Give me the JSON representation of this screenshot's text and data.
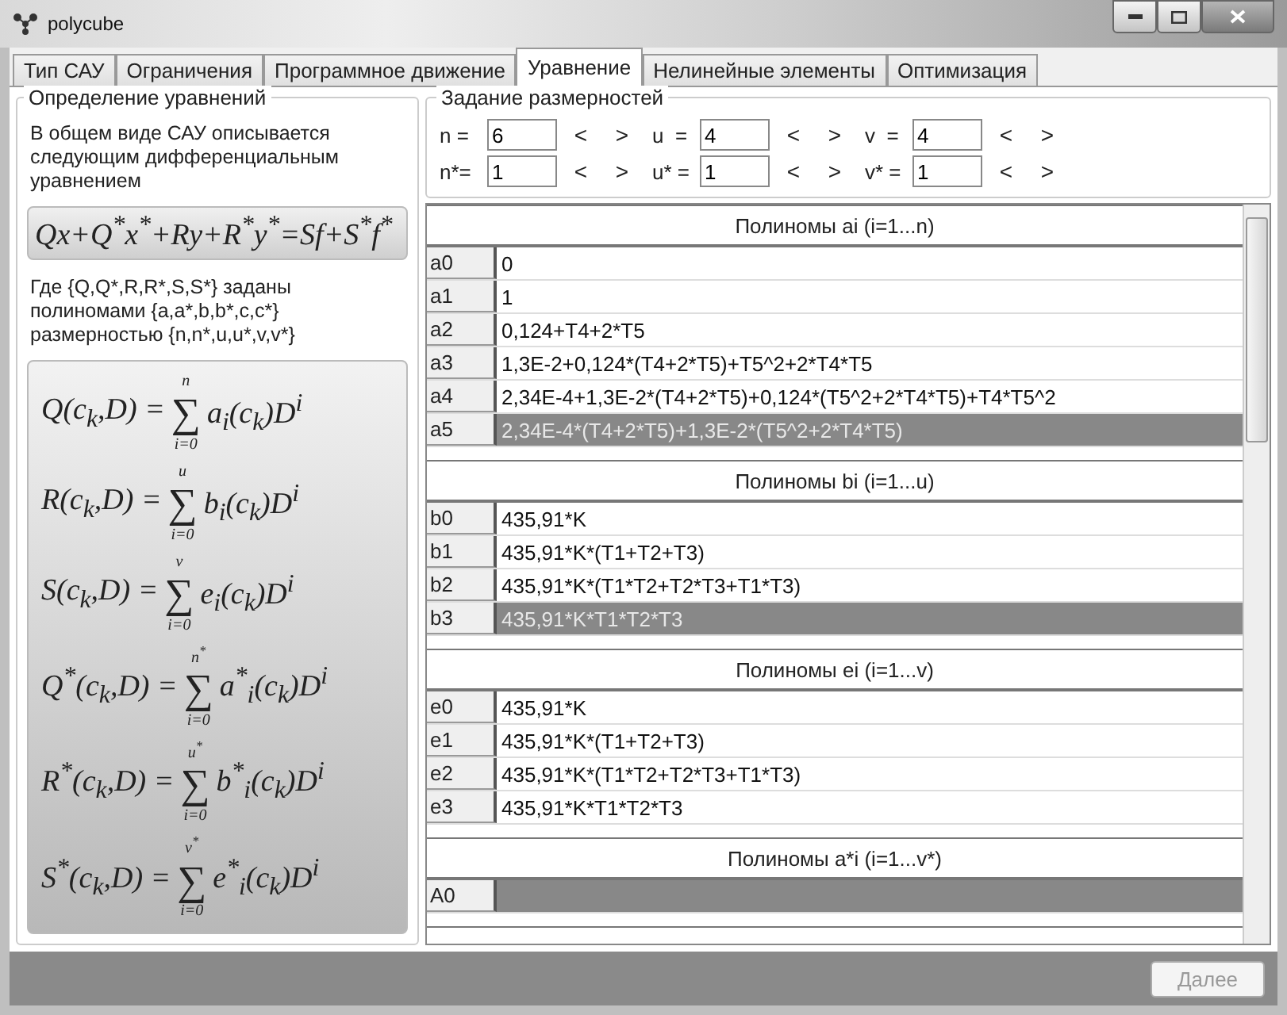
{
  "window": {
    "title": "polycube"
  },
  "tabs": [
    {
      "label": "Тип САУ",
      "selected": false
    },
    {
      "label": "Ограничения",
      "selected": false
    },
    {
      "label": "Программное движение",
      "selected": false
    },
    {
      "label": "Уравнение",
      "selected": true
    },
    {
      "label": "Нелинейные элементы",
      "selected": false
    },
    {
      "label": "Оптимизация",
      "selected": false
    }
  ],
  "definition": {
    "title": "Определение уравнений",
    "intro": "В общем виде САУ описывается следующим дифференциальным уравнением",
    "main_equation": "Qx+Q$^{*}$x$^{*}$+Ry+R$^{*}$y$^{*}$=Sf+S$^{*}$f$^{*}$",
    "note": "Где {Q,Q*,R,R*,S,S*} заданы полиномами {a,a*,b,b*,c,c*} размерностью {n,n*,u,u*,v,v*}",
    "formulas": [
      {
        "lhs": "Q(c$_{k}$,D) =",
        "sum": "∑",
        "upper": "n",
        "lower": "i=0",
        "rhs": "a$_{i}$(c$_{k}$)D$^{i}$"
      },
      {
        "lhs": "R(c$_{k}$,D) =",
        "sum": "∑",
        "upper": "u",
        "lower": "i=0",
        "rhs": "b$_{i}$(c$_{k}$)D$^{i}$"
      },
      {
        "lhs": "S(c$_{k}$,D) =",
        "sum": "∑",
        "upper": "v",
        "lower": "i=0",
        "rhs": "e$_{i}$(c$_{k}$)D$^{i}$"
      },
      {
        "lhs": "Q$^{*}$(c$_{k}$,D) =",
        "sum": "∑",
        "upper": "n$^{*}$",
        "lower": "i=0",
        "rhs": "a$^{*}$$_{i}$(c$_{k}$)D$^{i}$"
      },
      {
        "lhs": "R$^{*}$(c$_{k}$,D) =",
        "sum": "∑",
        "upper": "u$^{*}$",
        "lower": "i=0",
        "rhs": "b$^{*}$$_{i}$(c$_{k}$)D$^{i}$"
      },
      {
        "lhs": "S$^{*}$(c$_{k}$,D) =",
        "sum": "∑",
        "upper": "v$^{*}$",
        "lower": "i=0",
        "rhs": "e$^{*}$$_{i}$(c$_{k}$)D$^{i}$"
      }
    ]
  },
  "dimensions": {
    "title": "Задание размерностей",
    "spinners": [
      {
        "label": "n =",
        "value": "6",
        "dec": "<",
        "inc": ">"
      },
      {
        "label": "u  =",
        "value": "4",
        "dec": "<",
        "inc": ">"
      },
      {
        "label": "v  =",
        "value": "4",
        "dec": "<",
        "inc": ">"
      },
      {
        "label": "n*=",
        "value": "1",
        "dec": "<",
        "inc": ">"
      },
      {
        "label": "u* =",
        "value": "1",
        "dec": "<",
        "inc": ">"
      },
      {
        "label": "v* =",
        "value": "1",
        "dec": "<",
        "inc": ">"
      }
    ]
  },
  "sections": [
    {
      "title": "Полиномы ai (i=1...n)",
      "rows": [
        {
          "name": "a0",
          "value": "0",
          "selected": false
        },
        {
          "name": "a1",
          "value": "1",
          "selected": false
        },
        {
          "name": "a2",
          "value": "0,124+T4+2*T5",
          "selected": false
        },
        {
          "name": "a3",
          "value": "1,3E-2+0,124*(T4+2*T5)+T5^2+2*T4*T5",
          "selected": false
        },
        {
          "name": "a4",
          "value": "2,34E-4+1,3E-2*(T4+2*T5)+0,124*(T5^2+2*T4*T5)+T4*T5^2",
          "selected": false
        },
        {
          "name": "a5",
          "value": "2,34E-4*(T4+2*T5)+1,3E-2*(T5^2+2*T4*T5)",
          "selected": true
        }
      ]
    },
    {
      "title": "Полиномы bi (i=1...u)",
      "rows": [
        {
          "name": "b0",
          "value": "435,91*K",
          "selected": false
        },
        {
          "name": "b1",
          "value": "435,91*K*(T1+T2+T3)",
          "selected": false
        },
        {
          "name": "b2",
          "value": "435,91*K*(T1*T2+T2*T3+T1*T3)",
          "selected": false
        },
        {
          "name": "b3",
          "value": "435,91*K*T1*T2*T3",
          "selected": true
        }
      ]
    },
    {
      "title": "Полиномы ei (i=1...v)",
      "rows": [
        {
          "name": "e0",
          "value": "435,91*K",
          "selected": false
        },
        {
          "name": "e1",
          "value": "435,91*K*(T1+T2+T3)",
          "selected": false
        },
        {
          "name": "e2",
          "value": "435,91*K*(T1*T2+T2*T3+T1*T3)",
          "selected": false
        },
        {
          "name": "e3",
          "value": "435,91*K*T1*T2*T3",
          "selected": false
        }
      ]
    },
    {
      "title": "Полиномы a*i (i=1...v*)",
      "rows": [
        {
          "name": "A0",
          "value": "",
          "selected": true
        }
      ]
    }
  ],
  "footer": {
    "next_button": {
      "label": "Далее",
      "disabled": true
    }
  }
}
